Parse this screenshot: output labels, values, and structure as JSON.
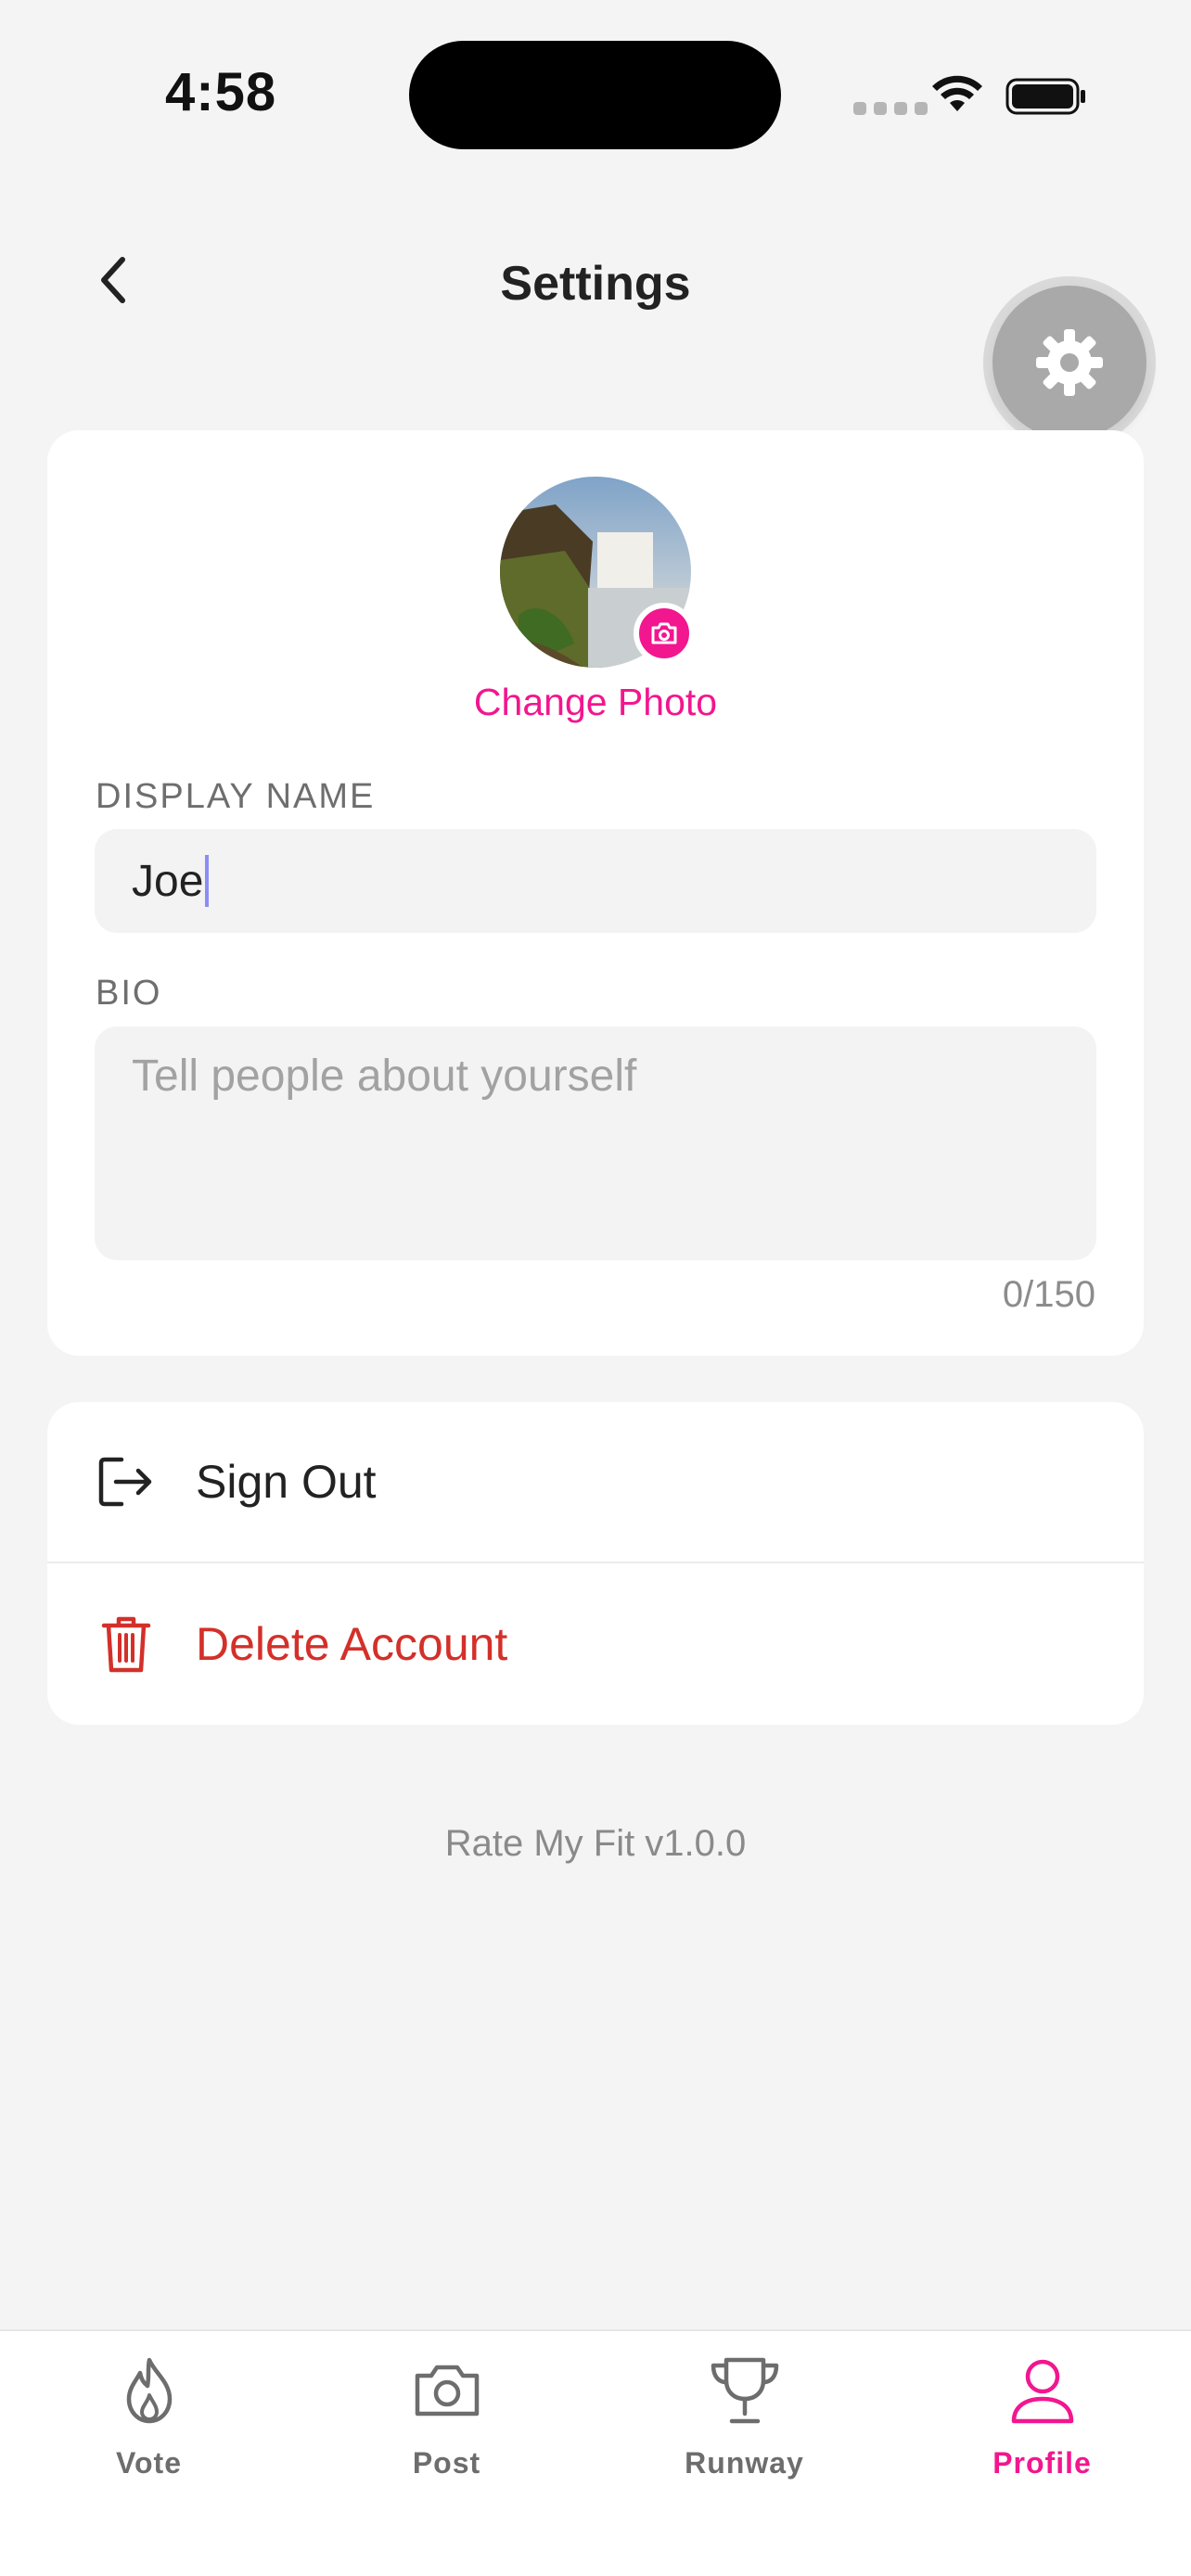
{
  "status_bar": {
    "time": "4:58"
  },
  "header": {
    "title": "Settings",
    "back_icon": "chevron-left-icon",
    "fab_icon": "gear-icon"
  },
  "profile": {
    "change_photo_label": "Change Photo",
    "display_name_label": "DISPLAY NAME",
    "display_name_value": "Joe",
    "bio_label": "BIO",
    "bio_placeholder": "Tell people about yourself",
    "bio_value": "",
    "bio_counter": "0/150"
  },
  "actions": [
    {
      "label": "Sign Out",
      "icon": "sign-out-icon",
      "color": "#222222"
    },
    {
      "label": "Delete Account",
      "icon": "trash-icon",
      "color": "#d3302a"
    }
  ],
  "version": "Rate My Fit v1.0.0",
  "tabs": [
    {
      "label": "Vote",
      "icon": "flame-icon",
      "active": false
    },
    {
      "label": "Post",
      "icon": "camera-icon",
      "active": false
    },
    {
      "label": "Runway",
      "icon": "trophy-icon",
      "active": false
    },
    {
      "label": "Profile",
      "icon": "person-icon",
      "active": true
    }
  ],
  "colors": {
    "accent": "#f2168f",
    "danger": "#d3302a",
    "background": "#f4f4f4",
    "card": "#ffffff"
  }
}
